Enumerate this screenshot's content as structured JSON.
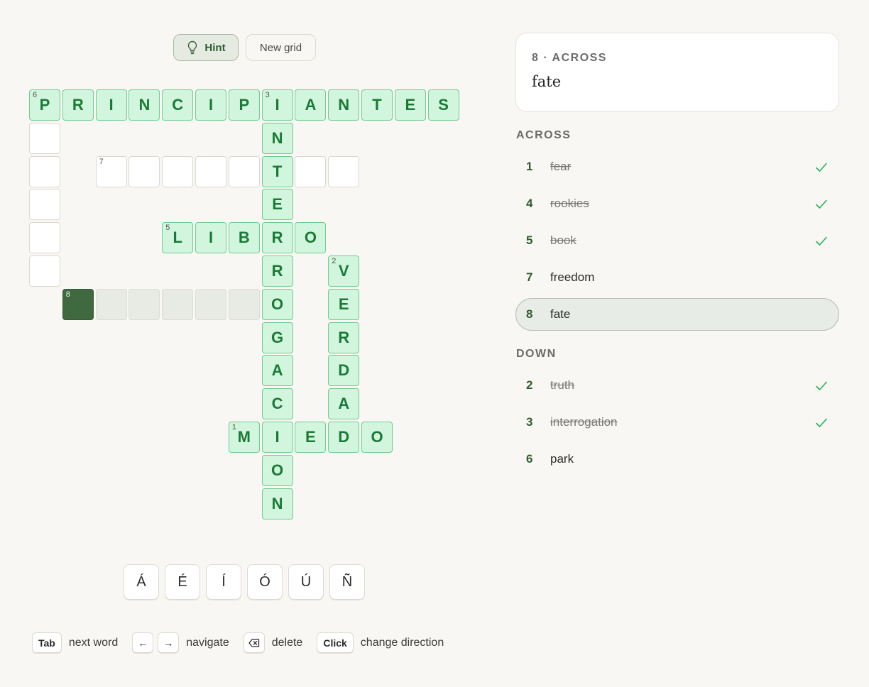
{
  "toolbar": {
    "hint_label": "Hint",
    "new_grid_label": "New grid"
  },
  "current_clue": {
    "ref": "8 · ACROSS",
    "text": "fate"
  },
  "across": {
    "title": "ACROSS",
    "clues": [
      {
        "num": "1",
        "text": "fear",
        "done": true
      },
      {
        "num": "4",
        "text": "rookies",
        "done": true
      },
      {
        "num": "5",
        "text": "book",
        "done": true
      },
      {
        "num": "7",
        "text": "freedom",
        "done": false
      },
      {
        "num": "8",
        "text": "fate",
        "done": false,
        "current": true
      }
    ]
  },
  "down": {
    "title": "DOWN",
    "clues": [
      {
        "num": "2",
        "text": "truth",
        "done": true
      },
      {
        "num": "3",
        "text": "interrogation",
        "done": true
      },
      {
        "num": "6",
        "text": "park",
        "done": false
      }
    ]
  },
  "grid": {
    "cells": [
      {
        "r": 0,
        "c": 0,
        "letter": "P",
        "state": "solved",
        "num": "6"
      },
      {
        "r": 0,
        "c": 1,
        "letter": "R",
        "state": "solved"
      },
      {
        "r": 0,
        "c": 2,
        "letter": "I",
        "state": "solved"
      },
      {
        "r": 0,
        "c": 3,
        "letter": "N",
        "state": "solved"
      },
      {
        "r": 0,
        "c": 4,
        "letter": "C",
        "state": "solved"
      },
      {
        "r": 0,
        "c": 5,
        "letter": "I",
        "state": "solved"
      },
      {
        "r": 0,
        "c": 6,
        "letter": "P",
        "state": "solved"
      },
      {
        "r": 0,
        "c": 7,
        "letter": "I",
        "state": "solved",
        "num": "3"
      },
      {
        "r": 0,
        "c": 8,
        "letter": "A",
        "state": "solved"
      },
      {
        "r": 0,
        "c": 9,
        "letter": "N",
        "state": "solved"
      },
      {
        "r": 0,
        "c": 10,
        "letter": "T",
        "state": "solved"
      },
      {
        "r": 0,
        "c": 11,
        "letter": "E",
        "state": "solved"
      },
      {
        "r": 0,
        "c": 12,
        "letter": "S",
        "state": "solved"
      },
      {
        "r": 1,
        "c": 0,
        "letter": "",
        "state": "empty"
      },
      {
        "r": 1,
        "c": 7,
        "letter": "N",
        "state": "solved"
      },
      {
        "r": 2,
        "c": 0,
        "letter": "",
        "state": "empty"
      },
      {
        "r": 2,
        "c": 2,
        "letter": "",
        "state": "empty",
        "num": "7"
      },
      {
        "r": 2,
        "c": 3,
        "letter": "",
        "state": "empty"
      },
      {
        "r": 2,
        "c": 4,
        "letter": "",
        "state": "empty"
      },
      {
        "r": 2,
        "c": 5,
        "letter": "",
        "state": "empty"
      },
      {
        "r": 2,
        "c": 6,
        "letter": "",
        "state": "empty"
      },
      {
        "r": 2,
        "c": 7,
        "letter": "T",
        "state": "solved"
      },
      {
        "r": 2,
        "c": 8,
        "letter": "",
        "state": "empty"
      },
      {
        "r": 2,
        "c": 9,
        "letter": "",
        "state": "empty"
      },
      {
        "r": 3,
        "c": 0,
        "letter": "",
        "state": "empty"
      },
      {
        "r": 3,
        "c": 7,
        "letter": "E",
        "state": "solved"
      },
      {
        "r": 4,
        "c": 0,
        "letter": "",
        "state": "empty"
      },
      {
        "r": 4,
        "c": 4,
        "letter": "L",
        "state": "solved",
        "num": "5"
      },
      {
        "r": 4,
        "c": 5,
        "letter": "I",
        "state": "solved"
      },
      {
        "r": 4,
        "c": 6,
        "letter": "B",
        "state": "solved"
      },
      {
        "r": 4,
        "c": 7,
        "letter": "R",
        "state": "solved"
      },
      {
        "r": 4,
        "c": 8,
        "letter": "O",
        "state": "solved"
      },
      {
        "r": 5,
        "c": 0,
        "letter": "",
        "state": "empty"
      },
      {
        "r": 5,
        "c": 7,
        "letter": "R",
        "state": "solved"
      },
      {
        "r": 5,
        "c": 9,
        "letter": "V",
        "state": "solved",
        "num": "2"
      },
      {
        "r": 6,
        "c": 1,
        "letter": "",
        "state": "cursor",
        "num": "8"
      },
      {
        "r": 6,
        "c": 2,
        "letter": "",
        "state": "active"
      },
      {
        "r": 6,
        "c": 3,
        "letter": "",
        "state": "active"
      },
      {
        "r": 6,
        "c": 4,
        "letter": "",
        "state": "active"
      },
      {
        "r": 6,
        "c": 5,
        "letter": "",
        "state": "active"
      },
      {
        "r": 6,
        "c": 6,
        "letter": "",
        "state": "active"
      },
      {
        "r": 6,
        "c": 7,
        "letter": "O",
        "state": "solved"
      },
      {
        "r": 6,
        "c": 9,
        "letter": "E",
        "state": "solved"
      },
      {
        "r": 7,
        "c": 7,
        "letter": "G",
        "state": "solved"
      },
      {
        "r": 7,
        "c": 9,
        "letter": "R",
        "state": "solved"
      },
      {
        "r": 8,
        "c": 7,
        "letter": "A",
        "state": "solved"
      },
      {
        "r": 8,
        "c": 9,
        "letter": "D",
        "state": "solved"
      },
      {
        "r": 9,
        "c": 7,
        "letter": "C",
        "state": "solved"
      },
      {
        "r": 9,
        "c": 9,
        "letter": "A",
        "state": "solved"
      },
      {
        "r": 10,
        "c": 6,
        "letter": "M",
        "state": "solved",
        "num": "1"
      },
      {
        "r": 10,
        "c": 7,
        "letter": "I",
        "state": "solved"
      },
      {
        "r": 10,
        "c": 8,
        "letter": "E",
        "state": "solved"
      },
      {
        "r": 10,
        "c": 9,
        "letter": "D",
        "state": "solved"
      },
      {
        "r": 10,
        "c": 10,
        "letter": "O",
        "state": "solved"
      },
      {
        "r": 11,
        "c": 7,
        "letter": "O",
        "state": "solved"
      },
      {
        "r": 12,
        "c": 7,
        "letter": "N",
        "state": "solved"
      }
    ]
  },
  "accents": [
    "Á",
    "É",
    "Í",
    "Ó",
    "Ú",
    "Ñ"
  ],
  "shortcuts": {
    "tab_key": "Tab",
    "tab_label": "next word",
    "left_key": "←",
    "right_key": "→",
    "nav_label": "navigate",
    "delete_label": "delete",
    "click_key": "Click",
    "click_label": "change direction"
  },
  "colors": {
    "solved_fill": "#d1f5dd",
    "solved_border": "#6fcd90",
    "solved_text": "#1a7a35",
    "cursor_fill": "#3f6a3f",
    "check": "#27b05a",
    "accent_green": "#2f5d33"
  }
}
